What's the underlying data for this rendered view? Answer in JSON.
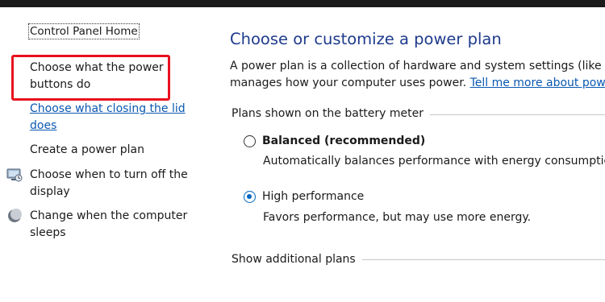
{
  "sidebar": {
    "home": "Control Panel Home",
    "items": [
      {
        "label": "Choose what the power buttons do",
        "icon": "none"
      },
      {
        "label": "Choose what closing the lid does",
        "icon": "none"
      },
      {
        "label": "Create a power plan",
        "icon": "none"
      },
      {
        "label": "Choose when to turn off the display",
        "icon": "display-icon"
      },
      {
        "label": "Change when the computer sleeps",
        "icon": "moon-icon"
      }
    ]
  },
  "main": {
    "title": "Choose or customize a power plan",
    "description_line1": "A power plan is a collection of hardware and system settings (like dis",
    "description_line2": "manages how your computer uses power.",
    "description_link": "Tell me more about power",
    "group_label": "Plans shown on the battery meter",
    "plans": [
      {
        "name": "Balanced (recommended)",
        "description": "Automatically balances performance with energy consumption",
        "selected": false
      },
      {
        "name": "High performance",
        "description": "Favors performance, but may use more energy.",
        "selected": true
      }
    ],
    "additional_plans_label": "Show additional plans"
  },
  "colors": {
    "title_blue": "#1e3a8c",
    "link_blue": "#0a58b0",
    "highlight_red": "#e8101e",
    "radio_blue": "#0067c0"
  }
}
